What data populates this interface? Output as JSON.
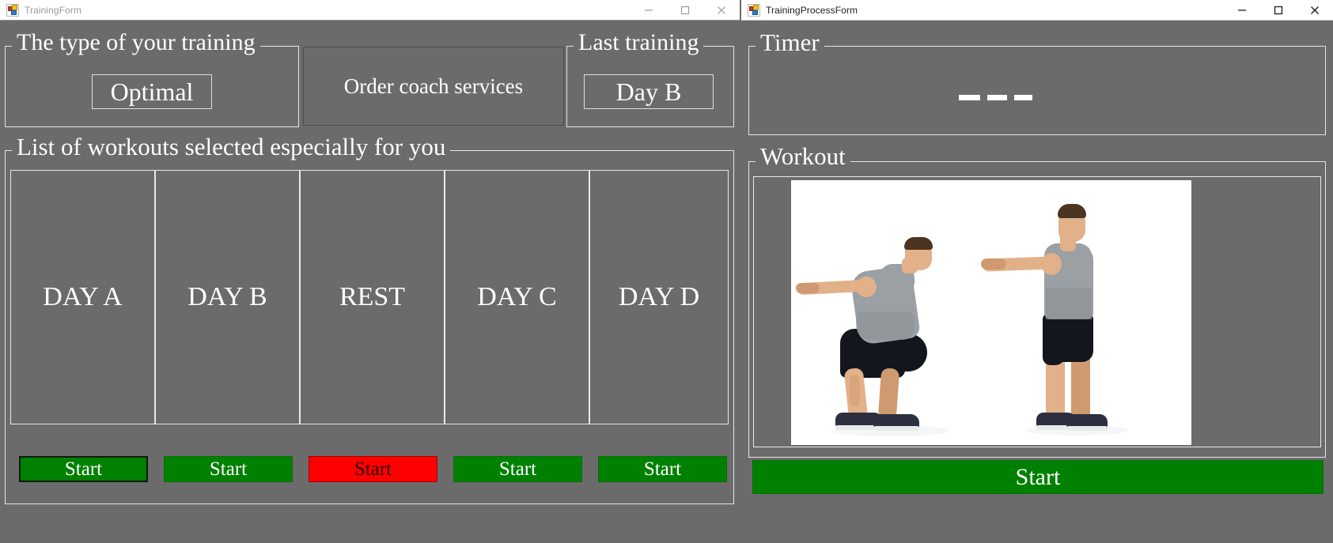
{
  "left_window": {
    "title": "TrainingForm",
    "icon": "winforms-icon",
    "controls": {
      "minimize": "minimize-icon",
      "maximize": "maximize-icon",
      "close": "close-icon"
    },
    "groups": {
      "training_type": {
        "legend": "The type of your training",
        "value": "Optimal"
      },
      "last_training": {
        "legend": "Last training",
        "value": "Day B"
      },
      "workouts": {
        "legend": "List of workouts selected especially for you"
      }
    },
    "order_coach_button": "Order coach services",
    "workout_cards": [
      {
        "title": "DAY A",
        "start_label": "Start",
        "state": "green",
        "focused": true
      },
      {
        "title": "DAY B",
        "start_label": "Start",
        "state": "green",
        "focused": false
      },
      {
        "title": "REST",
        "start_label": "Start",
        "state": "red",
        "focused": false
      },
      {
        "title": "DAY C",
        "start_label": "Start",
        "state": "green",
        "focused": false
      },
      {
        "title": "DAY D",
        "start_label": "Start",
        "state": "green",
        "focused": false
      }
    ]
  },
  "right_window": {
    "title": "TrainingProcessForm",
    "icon": "winforms-icon",
    "controls": {
      "minimize": "minimize-icon",
      "maximize": "maximize-icon",
      "close": "close-icon"
    },
    "groups": {
      "timer": {
        "legend": "Timer",
        "value": "— — —"
      },
      "workout": {
        "legend": "Workout",
        "image_alt": "bodyweight-squat-demonstration"
      }
    },
    "start_button": "Start"
  },
  "colors": {
    "form_background": "#6b6b6b",
    "text": "#ffffff",
    "start_green": "#008000",
    "start_red": "#ff0000",
    "titlebar": "#ffffff",
    "inactive_title_text": "#9a9a9a",
    "active_title_text": "#1c1c1c"
  }
}
